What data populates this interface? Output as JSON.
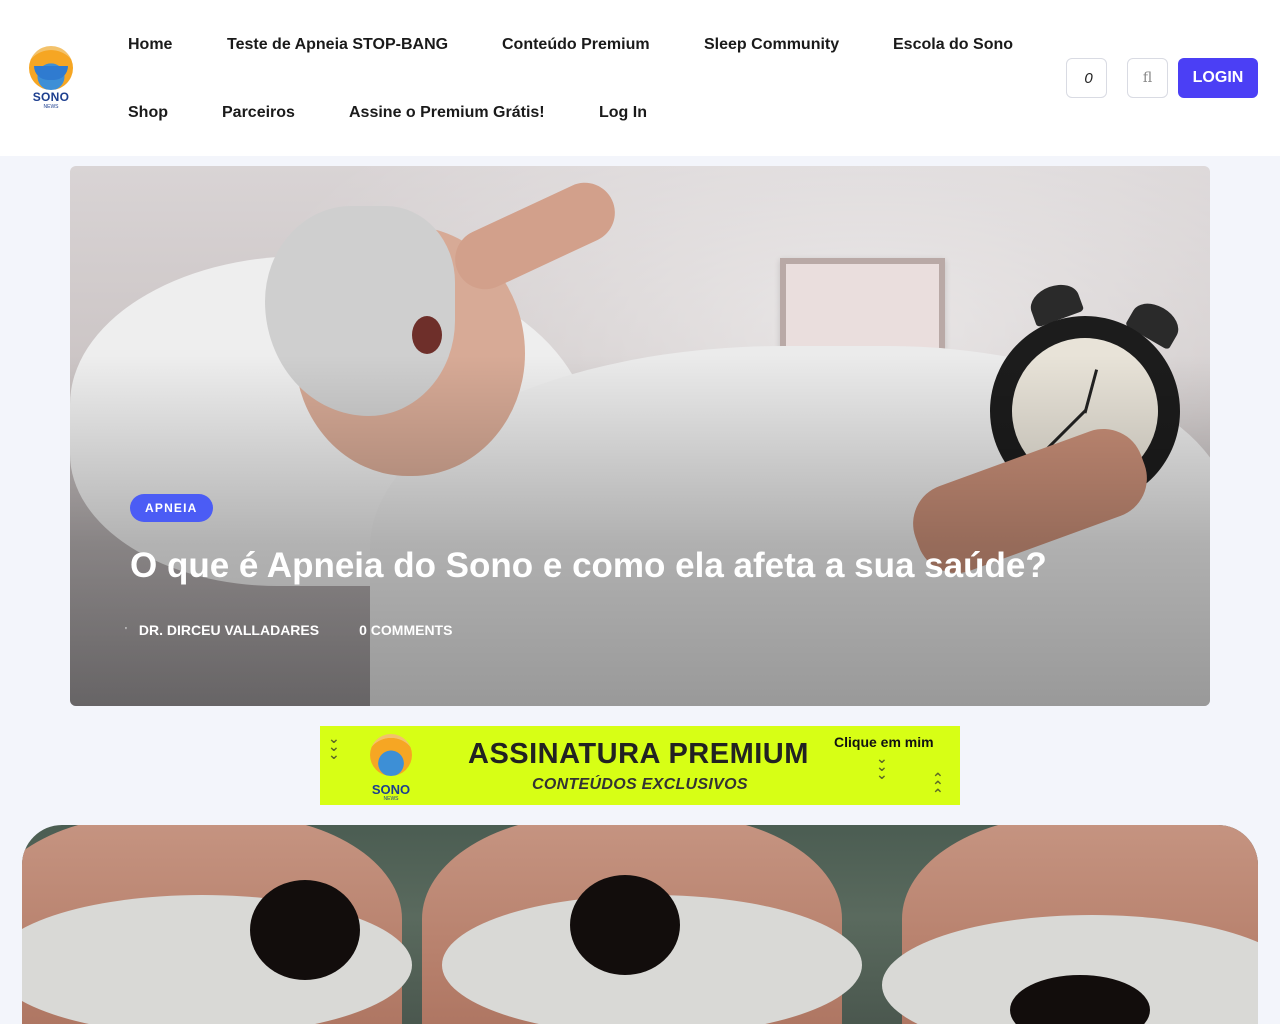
{
  "brand": {
    "logo_text": "SONO",
    "logo_sub": "NEWS"
  },
  "nav": {
    "items": [
      "Home",
      "Teste de Apneia STOP-BANG",
      "Conteúdo Premium",
      "Sleep Community",
      "Escola do Sono",
      "Shop",
      "Parceiros",
      "Assine o Premium Grátis!",
      "Log In"
    ]
  },
  "header_actions": {
    "cart_glyph": "",
    "cart_count": "0",
    "search_glyph": "fl",
    "login_label": "LOGIN"
  },
  "hero": {
    "category": "APNEIA",
    "title": "O que é Apneia do Sono e como ela afeta a sua saúde?",
    "author_glyph": "'",
    "author": "DR. DIRCEU VALLADARES",
    "comments_glyph": "",
    "comments": "0 COMMENTS"
  },
  "banner": {
    "logo_text": "SONO",
    "logo_sub": "NEWS",
    "title": "ASSINATURA PREMIUM",
    "subtitle": "CONTEÚDOS EXCLUSIVOS",
    "cta": "Clique em mim",
    "background_color": "#d7ff15"
  },
  "colors": {
    "accent": "#4b3ff5",
    "badge": "#4b5cf5",
    "page_bg": "#f3f5fb"
  }
}
